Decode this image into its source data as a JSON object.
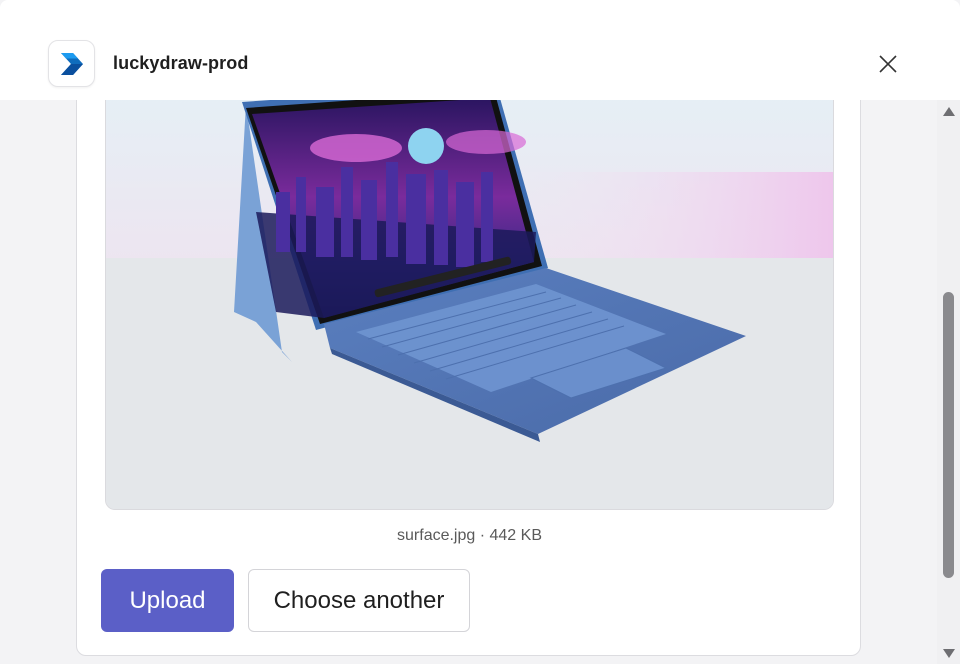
{
  "window": {
    "app_name": "luckydraw-prod",
    "app_icon": "power-automate-icon",
    "close_icon": "close-icon"
  },
  "preview": {
    "image_description": "surface-laptop-photo",
    "file_name": "surface.jpg",
    "file_size": "442 KB",
    "file_info": "surface.jpg · 442 KB"
  },
  "actions": {
    "upload_label": "Upload",
    "choose_another_label": "Choose another"
  },
  "colors": {
    "accent": "#5b5fc7",
    "background": "#f3f3f5",
    "card": "#ffffff"
  }
}
